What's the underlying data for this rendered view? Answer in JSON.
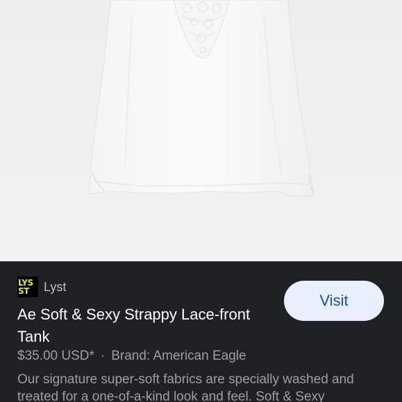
{
  "product": {
    "image_alt": "White strappy lace-front tank top"
  },
  "source": {
    "logo_lines": [
      "LYS",
      "ST"
    ],
    "name": "Lyst"
  },
  "visit_label": "Visit",
  "title": "Ae Soft & Sexy Strappy Lace-front Tank",
  "price": "$35.00 USD*",
  "separator": "·",
  "brand": "Brand: American Eagle",
  "description": "Our signature super-soft fabrics are specially washed and treated for a one-of-a-kind look and feel. Soft & Sexy",
  "colors": {
    "panel_bg": "#202124",
    "button_bg": "#e8f0fe",
    "button_text": "#174ea6",
    "logo_accent": "#c9f23a"
  }
}
